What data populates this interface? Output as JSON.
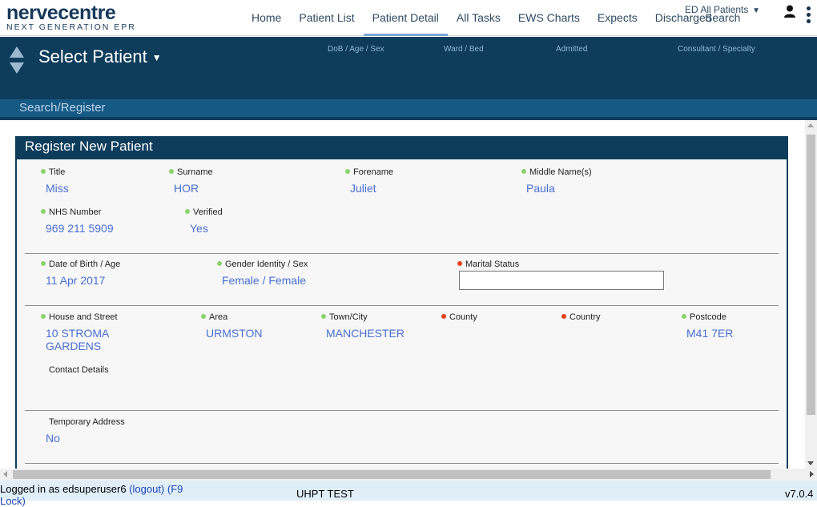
{
  "logo": {
    "main": "nervecentre",
    "sub": "NEXT GENERATION EPR"
  },
  "nav": {
    "items": [
      "Home",
      "Patient List",
      "Patient Detail",
      "All Tasks",
      "EWS Charts",
      "Expects",
      "Discharged"
    ],
    "active": "Patient Detail",
    "ed_all": "ED All Patients",
    "search": "Search"
  },
  "patient_header": {
    "title": "Select Patient",
    "columns": [
      "DoB / Age / Sex",
      "Ward / Bed",
      "Admitted",
      "Consultant / Specialty"
    ]
  },
  "searchbar": {
    "label": "Search/Register"
  },
  "panel": {
    "title": "Register New Patient",
    "fields": {
      "title": {
        "label": "Title",
        "value": "Miss"
      },
      "surname": {
        "label": "Surname",
        "value": "HOR"
      },
      "forename": {
        "label": "Forename",
        "value": "Juliet"
      },
      "middle": {
        "label": "Middle Name(s)",
        "value": "Paula"
      },
      "nhs": {
        "label": "NHS Number",
        "value": "969 211 5909"
      },
      "verified": {
        "label": "Verified",
        "value": "Yes"
      },
      "dob": {
        "label": "Date of Birth / Age",
        "value": "11 Apr 2017"
      },
      "gender": {
        "label": "Gender Identity / Sex",
        "value": "Female / Female"
      },
      "marital": {
        "label": "Marital Status",
        "value": ""
      },
      "house": {
        "label": "House and Street",
        "value_line1": "10 STROMA",
        "value_line2": "GARDENS"
      },
      "area": {
        "label": "Area",
        "value": "URMSTON"
      },
      "town": {
        "label": "Town/City",
        "value": "MANCHESTER"
      },
      "county": {
        "label": "County",
        "value": ""
      },
      "country": {
        "label": "Country",
        "value": ""
      },
      "postcode": {
        "label": "Postcode",
        "value": "M41 7ER"
      },
      "contact": {
        "label": "Contact Details"
      },
      "temp": {
        "label": "Temporary Address",
        "value": "No"
      }
    }
  },
  "footer": {
    "login_prefix": "Logged in as edsuperuser6",
    "logout": "(logout)",
    "f9": "(F9",
    "lock": "Lock)",
    "env": "UHPT TEST",
    "version": "v7.0.4"
  }
}
